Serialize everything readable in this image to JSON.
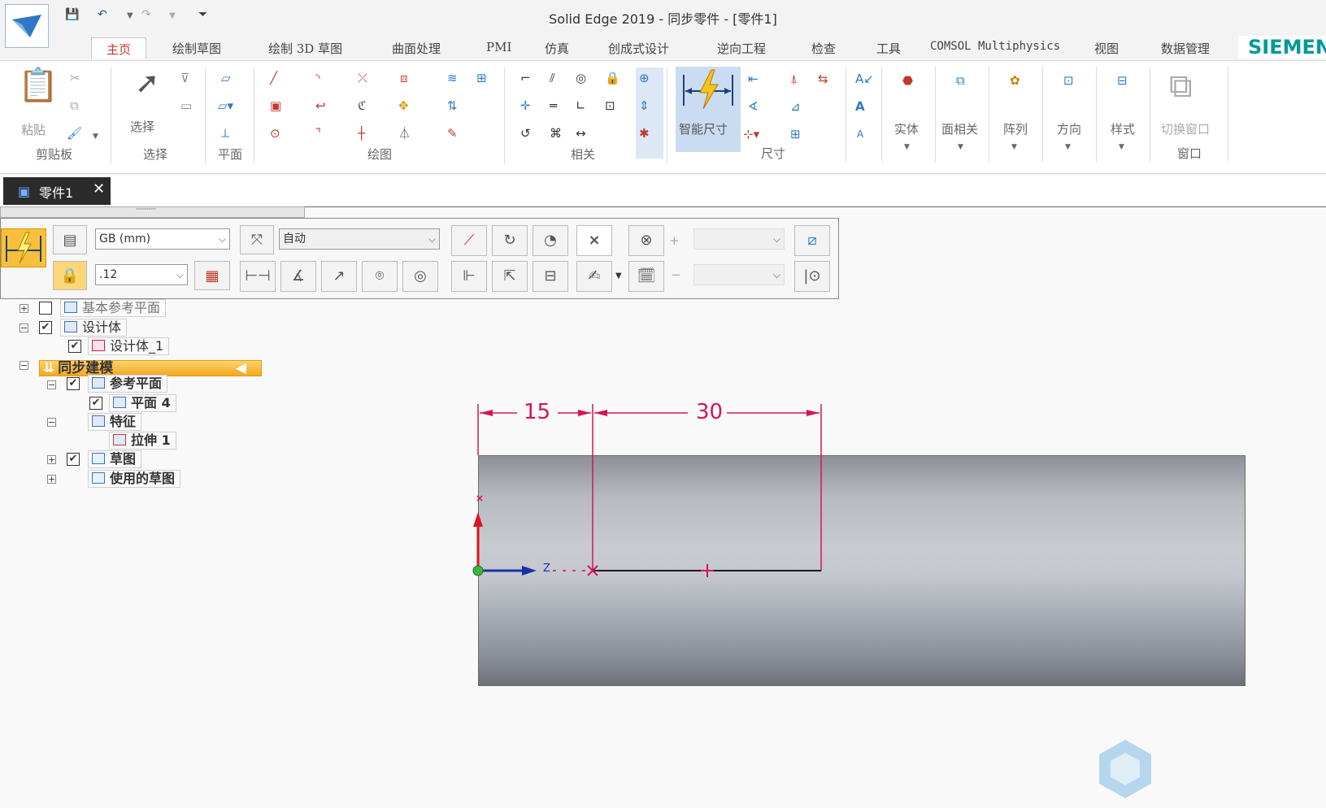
{
  "window": {
    "title": "Solid Edge 2019 - 同步零件 - [零件1]"
  },
  "ribbon_tabs": [
    "主页",
    "绘制草图",
    "绘制 3D 草图",
    "曲面处理",
    "PMI",
    "仿真",
    "创成式设计",
    "逆向工程",
    "检查",
    "工具",
    "COMSOL Multiphysics",
    "视图",
    "数据管理"
  ],
  "brand": "SIEMENS",
  "ribbon": {
    "groups": {
      "clipboard": "剪贴板",
      "select": "选择",
      "plane": "平面",
      "draw": "绘图",
      "relate": "相关",
      "dimension": "尺寸",
      "window": "窗口"
    },
    "buttons": {
      "paste": "粘贴",
      "select": "选择",
      "smart_dimension": "智能尺寸",
      "solids": "实体",
      "face_related": "面相关",
      "pattern": "阵列",
      "orient": "方向",
      "style": "样式",
      "switch_window": "切换窗口"
    }
  },
  "document_tab": {
    "label": "零件1"
  },
  "command_bar": {
    "standard": "GB (mm)",
    "mode": "自动",
    "precision": ".12"
  },
  "tree": {
    "base_planes": "基本参考平面",
    "design_body": "设计体",
    "design_body_1": "设计体_1",
    "synchronous": "同步建模",
    "ref_planes": "参考平面",
    "plane4": "平面 4",
    "features": "特征",
    "extrude1": "拉伸 1",
    "sketches": "草图",
    "used_sketches": "使用的草图"
  },
  "canvas": {
    "dim_15": "15",
    "dim_30": "30",
    "axis_label": "Z"
  },
  "colors": {
    "accent": "#c0392b",
    "dimension": "#d4145a",
    "smart_dim_bg": "#c9dcf2",
    "sync_highlight": "#f5b430"
  }
}
